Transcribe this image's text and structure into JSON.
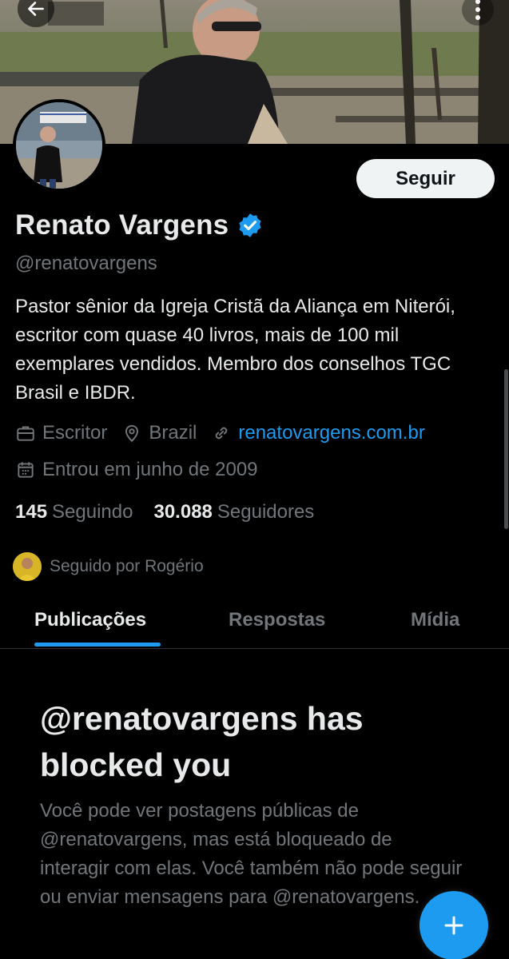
{
  "profile": {
    "name": "Renato Vargens",
    "handle": "@renatovargens",
    "bio": "Pastor sênior da Igreja Cristã da Aliança em Niterói, escritor com quase 40 livros, mais de 100 mil exemplares vendidos. Membro dos conselhos TGC Brasil e IBDR.",
    "profession": "Escritor",
    "location": "Brazil",
    "website": "renatovargens.com.br",
    "joined": "Entrou em junho de 2009",
    "following_count": "145",
    "following_label": "Seguindo",
    "followers_count": "30.088",
    "followers_label": "Seguidores",
    "followed_by": "Seguido por Rogério",
    "verified": true
  },
  "actions": {
    "follow_label": "Seguir"
  },
  "tabs": [
    {
      "label": "Publicações",
      "active": true
    },
    {
      "label": "Respostas",
      "active": false
    },
    {
      "label": "Mídia",
      "active": false
    }
  ],
  "blocked": {
    "title": "@renatovargens has blocked you",
    "message": "Você pode ver postagens públicas de @renatovargens, mas está bloqueado de interagir com elas. Você também não pode seguir ou enviar mensagens para @renatovargens."
  },
  "icons": {
    "back": "arrow-left-icon",
    "more": "more-vertical-icon",
    "verified": "verified-badge-icon",
    "profession": "briefcase-icon",
    "location": "location-pin-icon",
    "website": "link-icon",
    "joined": "calendar-icon",
    "compose": "plus-icon"
  },
  "colors": {
    "background": "#000000",
    "text": "#e7e9ea",
    "muted": "#71767b",
    "accent": "#1d9bf0",
    "follow_button_bg": "#eff3f4"
  }
}
